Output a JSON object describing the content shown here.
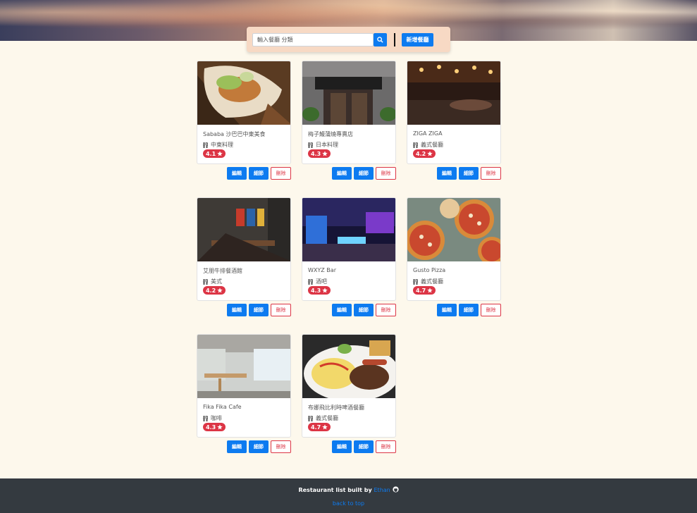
{
  "search": {
    "placeholder": "輸入餐廳 分類",
    "add_label": "新增餐廳"
  },
  "restaurants": [
    {
      "name": "Sababa 沙巴巴中東美食",
      "category": "中東料理",
      "rating": "4.1"
    },
    {
      "name": "梅子鰻蒲燒專賣店",
      "category": "日本料理",
      "rating": "4.3"
    },
    {
      "name": "ZIGA ZIGA",
      "category": "義式餐廳",
      "rating": "4.2"
    },
    {
      "name": "艾朋牛排餐酒館",
      "category": "美式",
      "rating": "4.2"
    },
    {
      "name": "WXYZ Bar",
      "category": "酒吧",
      "rating": "4.3"
    },
    {
      "name": "Gusto Pizza",
      "category": "義式餐廳",
      "rating": "4.7"
    },
    {
      "name": "Fika Fika Cafe",
      "category": "咖啡",
      "rating": "4.3"
    },
    {
      "name": "布娜飛比利時啤酒餐廳",
      "category": "義式餐廳",
      "rating": "4.7"
    }
  ],
  "actions": {
    "edit": "編輯",
    "detail": "細節",
    "delete": "刪除"
  },
  "footer": {
    "text": "Restaurant list built by",
    "author": "Ethan",
    "back_to_top": "back to top"
  },
  "colors": {
    "primary": "#0d7bf0",
    "danger": "#dc3545",
    "footer_bg": "#343a40",
    "page_bg": "#fdf8ec"
  }
}
